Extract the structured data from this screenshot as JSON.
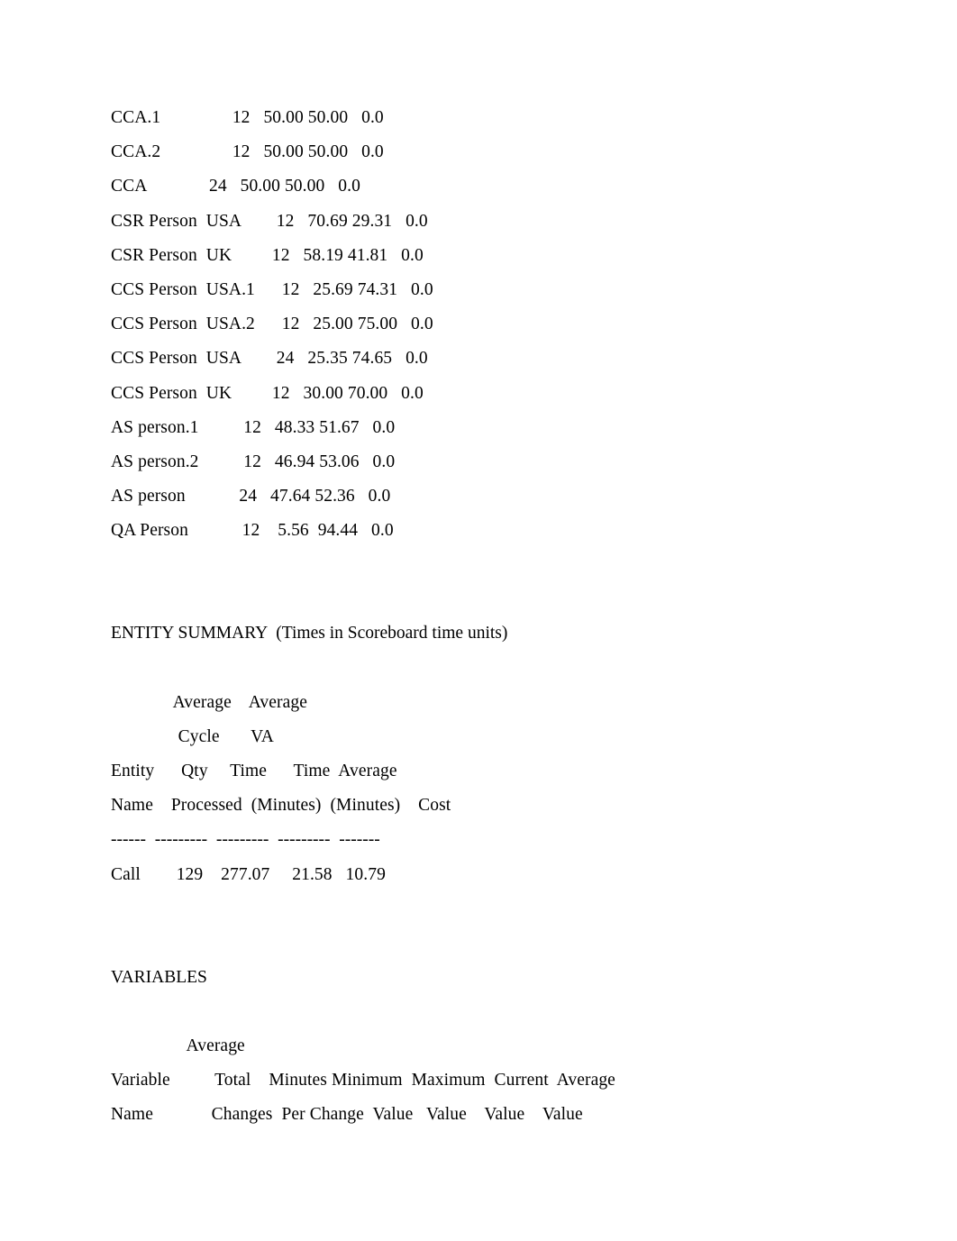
{
  "document": {
    "type": "simulation-output-report",
    "page_background": "#ffffff",
    "text_color": "#000000"
  },
  "resource_rows": [
    {
      "name": "CCA.1",
      "lead": "CCA.1",
      "qty": "12",
      "val1": "50.00",
      "val2": "50.00",
      "val3": "0.0",
      "indent": "              ",
      "raw": "CCA.1                12   50.00 50.00   0.0"
    },
    {
      "name": "CCA.2",
      "lead": "CCA.2",
      "qty": "12",
      "val1": "50.00",
      "val2": "50.00",
      "val3": "0.0",
      "indent": "              ",
      "raw": "CCA.2                12   50.00 50.00   0.0"
    },
    {
      "name": "CCA",
      "lead": "CCA",
      "qty": "24",
      "val1": "50.00",
      "val2": "50.00",
      "val3": "0.0",
      "indent": "            ",
      "raw": "CCA              24   50.00 50.00   0.0"
    },
    {
      "name": "CSR Person USA",
      "lead": "CSR Person  USA",
      "qty": "12",
      "val1": "70.69",
      "val2": "29.31",
      "val3": "0.0",
      "indent": "       ",
      "raw": "CSR Person  USA        12   70.69 29.31   0.0"
    },
    {
      "name": "CSR Person UK",
      "lead": "CSR Person  UK",
      "qty": "12",
      "val1": "58.19",
      "val2": "41.81",
      "val3": "0.0",
      "indent": "        ",
      "raw": "CSR Person  UK         12   58.19 41.81   0.0"
    },
    {
      "name": "CCS Person USA.1",
      "lead": "CCS Person  USA.1",
      "qty": "12",
      "val1": "25.69",
      "val2": "74.31",
      "val3": "0.0",
      "indent": "     ",
      "raw": "CCS Person  USA.1      12   25.69 74.31   0.0"
    },
    {
      "name": "CCS Person USA.2",
      "lead": "CCS Person  USA.2",
      "qty": "12",
      "val1": "25.00",
      "val2": "75.00",
      "val3": "0.0",
      "indent": "     ",
      "raw": "CCS Person  USA.2      12   25.00 75.00   0.0"
    },
    {
      "name": "CCS Person USA",
      "lead": "CCS Person  USA",
      "qty": "24",
      "val1": "25.35",
      "val2": "74.65",
      "val3": "0.0",
      "indent": "       ",
      "raw": "CCS Person  USA        24   25.35 74.65   0.0"
    },
    {
      "name": "CCS Person UK",
      "lead": "CCS Person  UK",
      "qty": "12",
      "val1": "30.00",
      "val2": "70.00",
      "val3": "0.0",
      "indent": "        ",
      "raw": "CCS Person  UK         12   30.00 70.00   0.0"
    },
    {
      "name": "AS person.1",
      "lead": "AS person.1",
      "qty": "12",
      "val1": "48.33",
      "val2": "51.67",
      "val3": "0.0",
      "indent": "          ",
      "raw": "AS person.1          12   48.33 51.67   0.0"
    },
    {
      "name": "AS person.2",
      "lead": "AS person.2",
      "qty": "12",
      "val1": "46.94",
      "val2": "53.06",
      "val3": "0.0",
      "indent": "          ",
      "raw": "AS person.2          12   46.94 53.06   0.0"
    },
    {
      "name": "AS person",
      "lead": "AS person",
      "qty": "24",
      "val1": "47.64",
      "val2": "52.36",
      "val3": "0.0",
      "indent": "            ",
      "raw": "AS person            24   47.64 52.36   0.0"
    },
    {
      "name": "QA Person",
      "lead": "QA Person",
      "qty": "12",
      "val1": "5.56",
      "val2": "94.44",
      "val3": "0.0",
      "indent": "           ",
      "raw": "QA Person            12    5.56  94.44   0.0"
    }
  ],
  "entity_summary": {
    "title": "ENTITY SUMMARY",
    "subtitle": "(Times in Scoreboard time units)",
    "title_line": "ENTITY SUMMARY  (Times in Scoreboard time units)",
    "header_line_1": "              Average    Average",
    "header_line_2": "               Cycle       VA",
    "header_line_3": "Entity      Qty     Time      Time  Average",
    "header_line_4": "Name    Processed  (Minutes)  (Minutes)    Cost",
    "rule_line": "------  ---------  ---------  ---------  -------",
    "header_col_1": "Average",
    "header_col_2": "Average",
    "header_col_3": "Cycle",
    "header_col_4": "VA",
    "columns": [
      {
        "top": "Entity",
        "bottom": "Name"
      },
      {
        "top": "Qty",
        "bottom": "Processed"
      },
      {
        "top": "Time",
        "bottom": "(Minutes)"
      },
      {
        "top": "Time",
        "bottom": "(Minutes)"
      },
      {
        "top": "Average",
        "bottom": "Cost"
      }
    ],
    "rows": [
      {
        "entity_name": "Call",
        "qty_processed": "129",
        "avg_cycle_time_minutes": "277.07",
        "avg_va_time_minutes": "21.58",
        "average_cost": "10.79",
        "raw": "Call        129    277.07     21.58   10.79"
      }
    ]
  },
  "variables": {
    "title": "VARIABLES",
    "header_line_0": "                 Average",
    "header_line_1": "Variable          Total    Minutes Minimum  Maximum  Current  Average",
    "header_line_2": "Name             Changes  Per Change  Value   Value    Value    Value",
    "header_col_average": "Average",
    "columns": [
      {
        "top": "Variable",
        "bottom": "Name"
      },
      {
        "top": "Total",
        "bottom": "Changes"
      },
      {
        "top": "Minutes",
        "bottom": "Per Change"
      },
      {
        "top": "Minimum",
        "bottom": "Value"
      },
      {
        "top": "Maximum",
        "bottom": "Value"
      },
      {
        "top": "Current",
        "bottom": "Value"
      },
      {
        "top": "Average",
        "bottom": "Value"
      }
    ],
    "rows": []
  }
}
